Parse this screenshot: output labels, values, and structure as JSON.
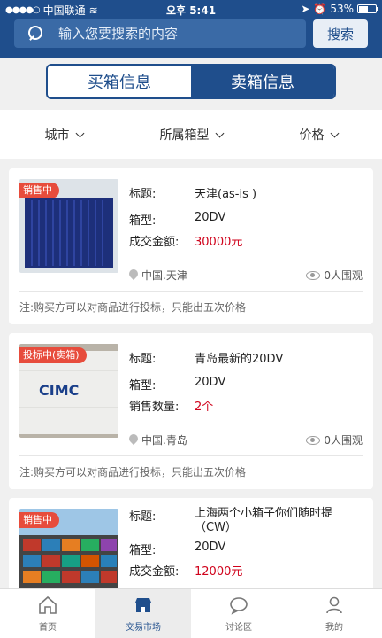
{
  "status_bar": {
    "carrier": "中国联通",
    "time": "오후 5:41",
    "battery": "53%",
    "battery_level": 0.53
  },
  "search": {
    "placeholder": "输入您要搜索的内容",
    "button": "搜索"
  },
  "segment": {
    "buy": "买箱信息",
    "sell": "卖箱信息"
  },
  "filters": [
    {
      "label": "城市"
    },
    {
      "label": "所属箱型"
    },
    {
      "label": "价格"
    }
  ],
  "listings": [
    {
      "badge": "销售中",
      "title_label": "标题:",
      "title": "天津(as-is )",
      "type_label": "箱型:",
      "type": "20DV",
      "price_label": "成交金额:",
      "price": "30000元",
      "location": "中国.天津",
      "views": "0人围观",
      "note": "注:购买方可以对商品进行投标，只能出五次价格"
    },
    {
      "badge": "投标中(卖箱)",
      "title_label": "标题:",
      "title": "青岛最新的20DV",
      "type_label": "箱型:",
      "type": "20DV",
      "price_label": "销售数量:",
      "price": "2个",
      "location": "中国.青岛",
      "views": "0人围观",
      "note": "注:购买方可以对商品进行投标，只能出五次价格"
    },
    {
      "badge": "销售中",
      "title_label": "标题:",
      "title": "上海两个小箱子你们随时提（CW）",
      "type_label": "箱型:",
      "type": "20DV",
      "price_label": "成交金额:",
      "price": "12000元"
    }
  ],
  "tabbar": [
    {
      "label": "首页"
    },
    {
      "label": "交易市场"
    },
    {
      "label": "讨论区"
    },
    {
      "label": "我的"
    }
  ],
  "colors": {
    "primary": "#1f4e8c",
    "badge": "#e74c3c",
    "price": "#d0021b"
  }
}
